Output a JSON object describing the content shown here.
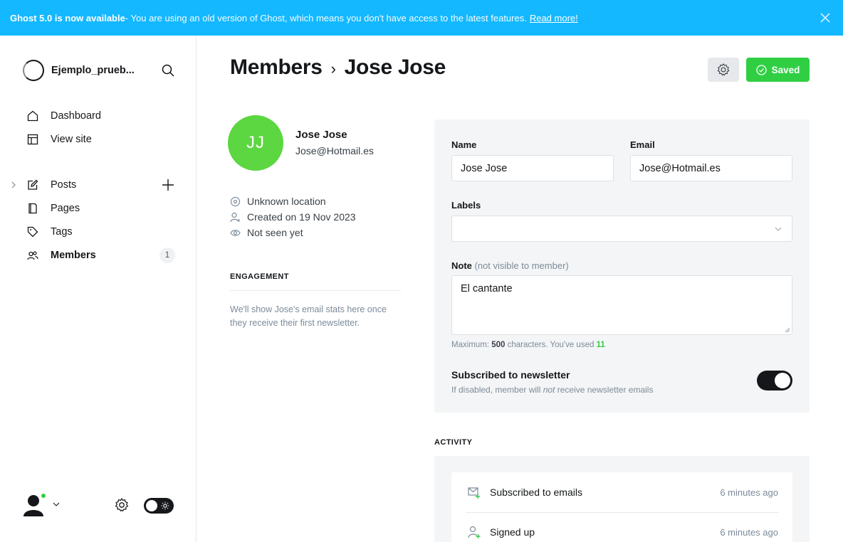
{
  "banner": {
    "title": "Ghost 5.0 is now available",
    "message": " - You are using an old version of Ghost, which means you don't have access to the latest features.",
    "link": "Read more!",
    "close_icon": "close-icon",
    "color": "#14b8ff"
  },
  "sidebar": {
    "site_name": "Ejemplo_prueb...",
    "search_icon": "search-icon",
    "nav": [
      {
        "label": "Dashboard",
        "icon": "home-icon"
      },
      {
        "label": "View site",
        "icon": "layout-icon"
      }
    ],
    "content_nav": [
      {
        "label": "Posts",
        "icon": "pencil-icon"
      },
      {
        "label": "Pages",
        "icon": "page-icon"
      },
      {
        "label": "Tags",
        "icon": "tag-icon"
      },
      {
        "label": "Members",
        "icon": "members-icon",
        "count": "1",
        "active": true
      }
    ]
  },
  "header": {
    "section": "Members",
    "separator": "›",
    "member": "Jose Jose",
    "saved_label": "Saved",
    "accent": "#30cf43"
  },
  "member": {
    "initials": "JJ",
    "name": "Jose Jose",
    "email": "Jose@Hotmail.es",
    "location": "Unknown location",
    "created": "Created on 19 Nov 2023",
    "seen": "Not seen yet",
    "avatar_color": "#5cd641"
  },
  "engagement": {
    "title": "ENGAGEMENT",
    "text": "We'll show Jose's email stats here once they receive their first newsletter."
  },
  "form": {
    "name_label": "Name",
    "name_value": "Jose Jose",
    "email_label": "Email",
    "email_value": "Jose@Hotmail.es",
    "labels_label": "Labels",
    "note_label": "Note",
    "note_sub": "(not visible to member)",
    "note_value": "El cantante",
    "counter_prefix": "Maximum: ",
    "counter_max": "500",
    "counter_mid": " characters. You've used ",
    "counter_used": "11",
    "newsletter_title": "Subscribed to newsletter",
    "newsletter_sub_1": "If disabled, member will ",
    "newsletter_sub_em": "not",
    "newsletter_sub_2": " receive newsletter emails",
    "newsletter_on": true
  },
  "activity": {
    "title": "ACTIVITY",
    "items": [
      {
        "text": "Subscribed to emails",
        "time": "6 minutes ago",
        "icon": "mail-plus-icon"
      },
      {
        "text": "Signed up",
        "time": "6 minutes ago",
        "icon": "user-plus-icon"
      }
    ]
  }
}
